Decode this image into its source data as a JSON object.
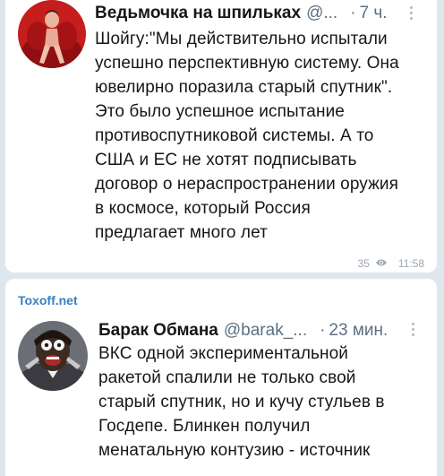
{
  "post1": {
    "author": "Ведьмочка на шпильках",
    "handle": "@...",
    "dot": "·",
    "time": "7 ч.",
    "text": "Шойгу:\"Мы действительно испытали\nуспешно перспективную систему. Она\nювелирно поразила старый спутник\".\nЭто было успешное испытание\nпротивоспутниковой системы. А то\nСША и ЕС не хотят подписывать\nдоговор о нераспространении оружия\nв космосе, который Россия\nпредлагает много лет",
    "views": "35",
    "post_time": "11:58",
    "icons": {
      "avatar": "avatar-woman-red-chair",
      "more": "more-vertical-icon",
      "views": "eye-icon"
    }
  },
  "post2": {
    "channel": "Toxoff.net",
    "author": "Барак Обмана",
    "handle": "@barak_...",
    "dot": "·",
    "time": "23 мин.",
    "text": "ВКС одной экспериментальной\nракетой спалили не только свой\nстарый спутник, но и кучу стульев в\nГосдепе. Блинкен получил\nменатальную  контузию - источник",
    "icons": {
      "avatar": "avatar-shocked-man",
      "more": "more-vertical-icon"
    }
  },
  "colors": {
    "background": "#dfe7ee",
    "card": "#ffffff",
    "text": "#14171a",
    "muted": "#5b7083",
    "channel_link": "#3a7fc4"
  }
}
